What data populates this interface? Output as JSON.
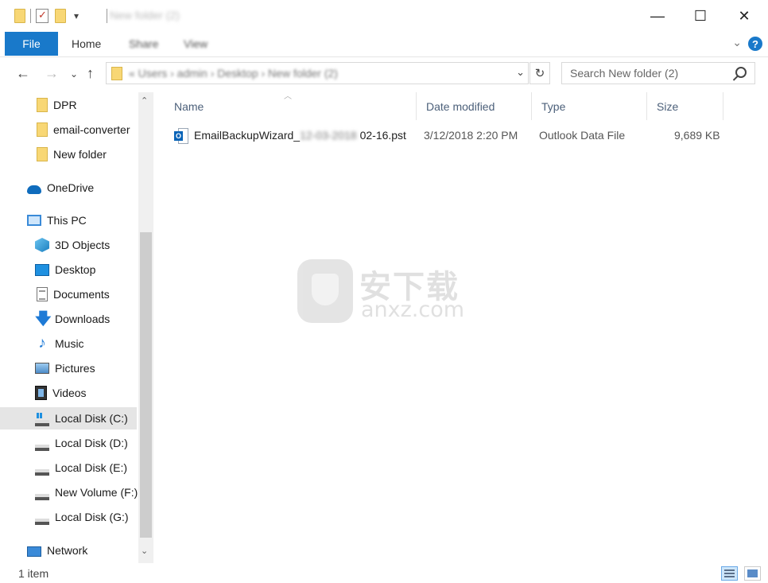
{
  "window": {
    "title": "New folder (2)",
    "minimize": "—",
    "maximize": "☐",
    "close": "✕"
  },
  "ribbon": {
    "tabs": [
      {
        "label": "File"
      },
      {
        "label": "Home"
      },
      {
        "label": "Share"
      },
      {
        "label": "View"
      }
    ],
    "help": "?"
  },
  "address": {
    "crumbs": "«  Users  ›  admin  ›  Desktop  ›  New folder (2)",
    "search_placeholder": "Search New folder (2)"
  },
  "nav": {
    "items": [
      {
        "label": "DPR",
        "icon": "folder-icon"
      },
      {
        "label": "email-converter",
        "icon": "folder-icon"
      },
      {
        "label": "New folder",
        "icon": "folder-icon"
      },
      {
        "label": "OneDrive",
        "icon": "onedrive-icon"
      },
      {
        "label": "This PC",
        "icon": "computer-icon"
      },
      {
        "label": "3D Objects",
        "icon": "3d-objects-icon"
      },
      {
        "label": "Desktop",
        "icon": "desktop-icon"
      },
      {
        "label": "Documents",
        "icon": "documents-icon"
      },
      {
        "label": "Downloads",
        "icon": "downloads-icon"
      },
      {
        "label": "Music",
        "icon": "music-icon"
      },
      {
        "label": "Pictures",
        "icon": "pictures-icon"
      },
      {
        "label": "Videos",
        "icon": "videos-icon"
      },
      {
        "label": "Local Disk (C:)",
        "icon": "system-drive-icon",
        "selected": true
      },
      {
        "label": "Local Disk (D:)",
        "icon": "drive-icon"
      },
      {
        "label": "Local Disk (E:)",
        "icon": "drive-icon"
      },
      {
        "label": "New Volume (F:)",
        "icon": "drive-icon"
      },
      {
        "label": "Local Disk (G:)",
        "icon": "drive-icon"
      },
      {
        "label": "Network",
        "icon": "network-icon"
      }
    ]
  },
  "columns": {
    "name": "Name",
    "date": "Date modified",
    "type": "Type",
    "size": "Size"
  },
  "files": [
    {
      "name_prefix": "EmailBackupWizard_",
      "name_blurred": "12-03-2018",
      "name_suffix": "02-16.pst",
      "date": "3/12/2018 2:20 PM",
      "type": "Outlook Data File",
      "size": "9,689 KB",
      "icon": "outlook-data-file-icon"
    }
  ],
  "watermark": {
    "cn": "安下载",
    "en": "anxz.com"
  },
  "status": {
    "count": "1 item"
  }
}
